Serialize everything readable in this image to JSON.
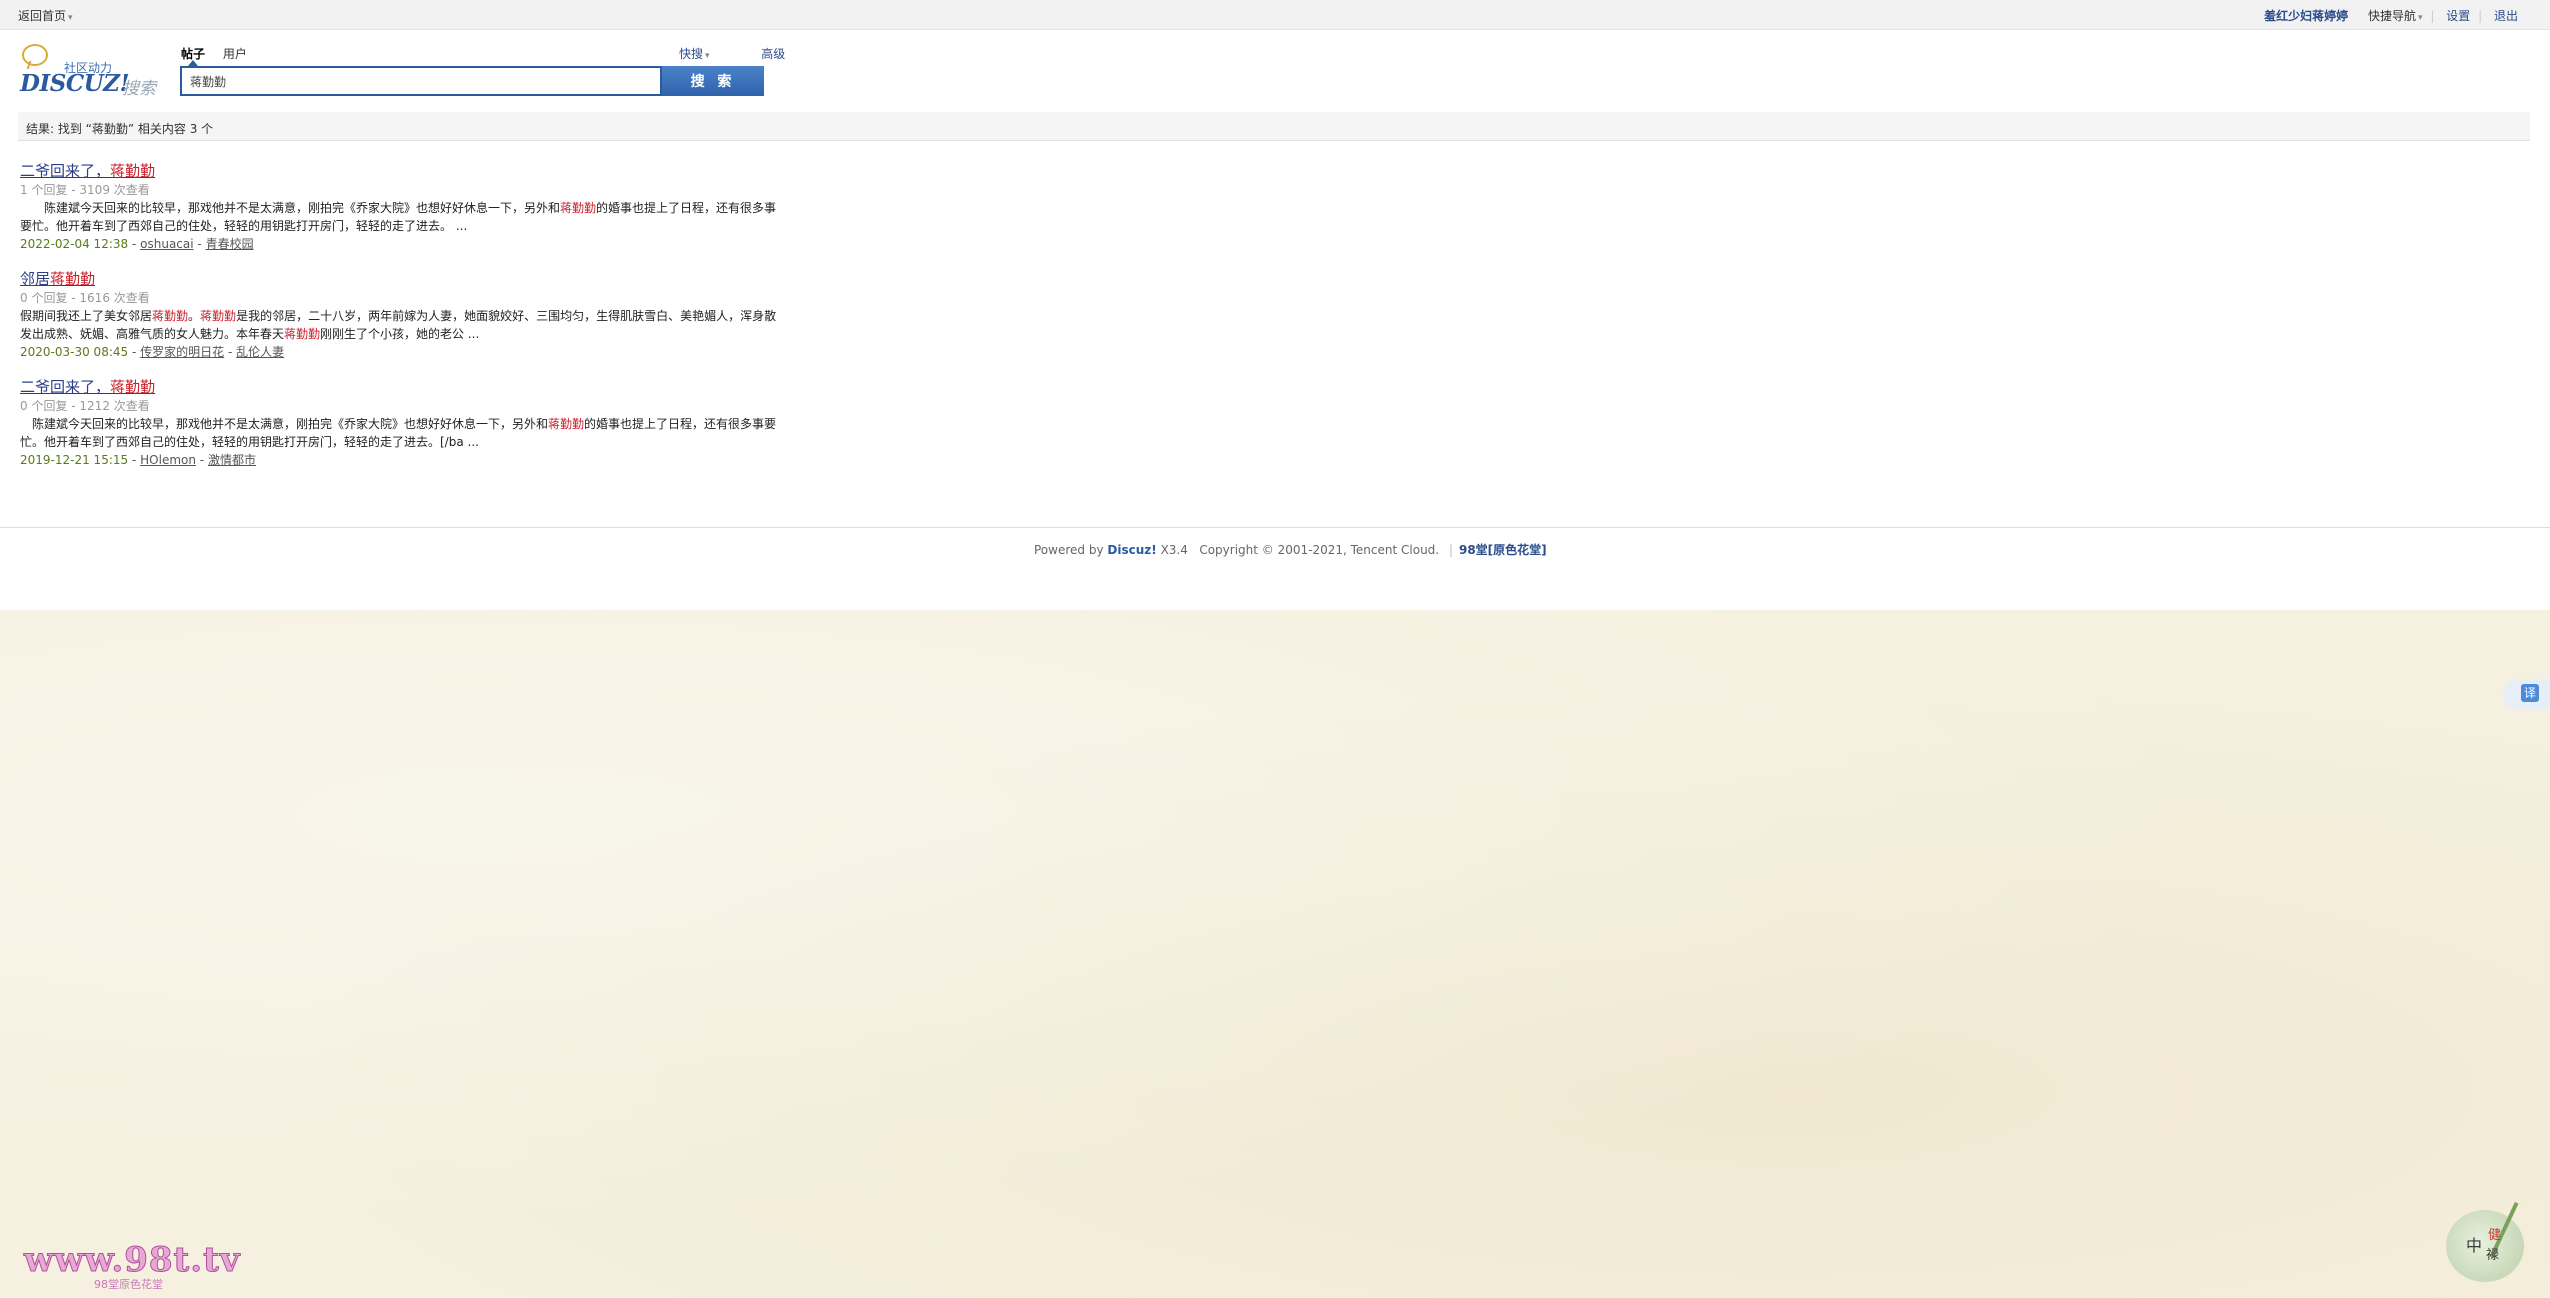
{
  "topbar": {
    "home": "返回首页",
    "user": "羞红少妇蒋婷婷",
    "quicknav": "快捷导航",
    "settings": "设置",
    "logout": "退出"
  },
  "logo": {
    "slogan": "社区动力",
    "brand": "DISCUZ!",
    "sub": "搜索"
  },
  "search": {
    "tabs": [
      "帖子",
      "用户"
    ],
    "quick": "快搜",
    "advanced": "高级",
    "query": "蒋勤勤",
    "button": "搜 索"
  },
  "summary": "结果: 找到 “蒋勤勤” 相关内容 3 个",
  "results": [
    {
      "title_pre": "二爷回来了，",
      "title_hl": "蒋勤勤",
      "meta": "1 个回复 - 3109 次查看",
      "excerpt_1": "　　陈建斌今天回来的比较早，那戏他并不是太满意，刚拍完《乔家大院》也想好好休息一下，另外和",
      "excerpt_hl": "蒋勤勤",
      "excerpt_2": "的婚事也提上了日程，还有很多事要忙。他开着车到了西郊自己的住处，轻轻的用钥匙打开房门，轻轻的走了进去。 ...",
      "date": "2022-02-04 12:38",
      "author": "oshuacai",
      "forum": "青春校园"
    },
    {
      "title_pre": "邻居",
      "title_hl": "蒋勤勤",
      "meta": "0 个回复 - 1616 次查看",
      "excerpt_1": "假期间我还上了美女邻居",
      "excerpt_hl": "蒋勤勤",
      "excerpt_2": "。",
      "excerpt_hl2": "蒋勤勤",
      "excerpt_3": "是我的邻居，二十八岁，两年前嫁为人妻，她面貌姣好、三围均匀，生得肌肤雪白、美艳媚人，浑身散发出成熟、妩媚、高雅气质的女人魅力。本年春天",
      "excerpt_hl3": "蒋勤勤",
      "excerpt_4": "刚刚生了个小孩，她的老公 ...",
      "date": "2020-03-30 08:45",
      "author": "传罗家的明日花",
      "forum": "乱伦人妻"
    },
    {
      "title_pre": "二爷回来了，",
      "title_hl": "蒋勤勤",
      "meta": "0 个回复 - 1212 次查看",
      "excerpt_1": "　陈建斌今天回来的比较早，那戏他并不是太满意，刚拍完《乔家大院》也想好好休息一下，另外和",
      "excerpt_hl": "蒋勤勤",
      "excerpt_2": "的婚事也提上了日程，还有很多事要忙。他开着车到了西郊自己的住处，轻轻的用钥匙打开房门，轻轻的走了进去。[/ba ...",
      "date": "2019-12-21 15:15",
      "author": "HOlemon",
      "forum": "激情都市"
    }
  ],
  "footer": {
    "powered": "Powered by",
    "dz": "Discuz!",
    "version": "X3.4",
    "copyright": "Copyright © 2001-2021, Tencent Cloud.",
    "site": "98堂[原色花堂]"
  },
  "translate_label": "译",
  "watermark": {
    "logo": "www.98t.tv",
    "sub": "98堂原色花堂"
  },
  "seal": {
    "c1": "中",
    "c2": "禄",
    "c3": "健"
  },
  "colors": {
    "accent": "#2c5aa0",
    "highlight": "#c8202a",
    "date": "#5a7a1a"
  }
}
